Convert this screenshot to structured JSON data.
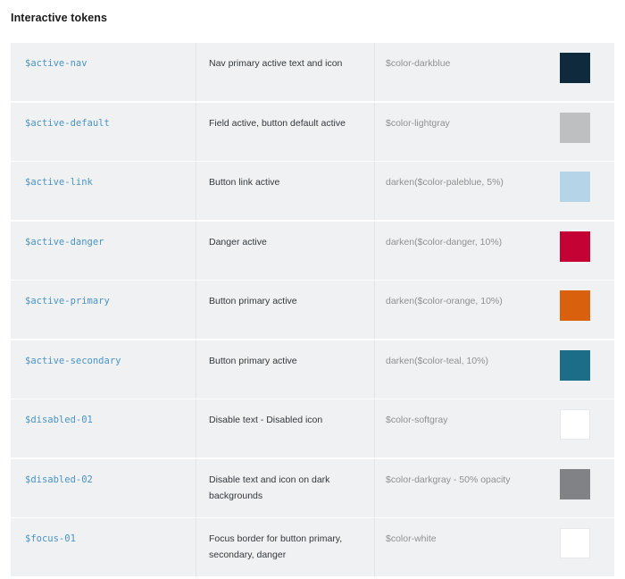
{
  "section": {
    "title": "Interactive tokens"
  },
  "table": {
    "rows": [
      {
        "token": "$active-nav",
        "description": "Nav primary active text and icon",
        "value": "$color-darkblue",
        "swatch_color": "#0f2a3c",
        "swatch_bordered": false,
        "swatch_name": "swatch-color-darkblue"
      },
      {
        "token": "$active-default",
        "description": "Field active, button default active",
        "value": "$color-lightgray",
        "swatch_color": "#bdbfc1",
        "swatch_bordered": false,
        "swatch_name": "swatch-color-lightgray"
      },
      {
        "token": "$active-link",
        "description": "Button link active",
        "value": "darken($color-paleblue, 5%)",
        "swatch_color": "#b6d4e7",
        "swatch_bordered": false,
        "swatch_name": "swatch-color-paleblue-darken-5"
      },
      {
        "token": "$active-danger",
        "description": "Danger active",
        "value": "darken($color-danger, 10%)",
        "swatch_color": "#c40233",
        "swatch_bordered": false,
        "swatch_name": "swatch-color-danger-darken-10"
      },
      {
        "token": "$active-primary",
        "description": "Button primary active",
        "value": "darken($color-orange, 10%)",
        "swatch_color": "#d9600d",
        "swatch_bordered": false,
        "swatch_name": "swatch-color-orange-darken-10"
      },
      {
        "token": "$active-secondary",
        "description": "Button primary active",
        "value": "darken($color-teal, 10%)",
        "swatch_color": "#1c6e88",
        "swatch_bordered": false,
        "swatch_name": "swatch-color-teal-darken-10"
      },
      {
        "token": "$disabled-01",
        "description": "Disable text - Disabled icon",
        "value": "$color-softgray",
        "swatch_color": "#ffffff",
        "swatch_bordered": true,
        "swatch_name": "swatch-color-softgray"
      },
      {
        "token": "$disabled-02",
        "description": "Disable text and icon on dark backgrounds",
        "value": "$color-darkgray - 50% opacity",
        "swatch_color": "#808285",
        "swatch_bordered": false,
        "swatch_name": "swatch-color-darkgray-50-opacity"
      },
      {
        "token": "$focus-01",
        "description": "Focus border for button primary, secondary, danger",
        "value": "$color-white",
        "swatch_color": "#ffffff",
        "swatch_bordered": true,
        "swatch_name": "swatch-color-white"
      }
    ]
  }
}
